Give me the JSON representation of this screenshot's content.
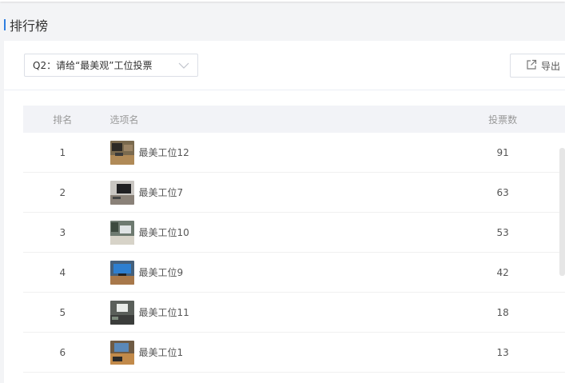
{
  "header": {
    "title": "排行榜"
  },
  "toolbar": {
    "question_select_value": "Q2：请给“最美观”工位投票",
    "export_label": "导出"
  },
  "table": {
    "columns": {
      "rank": "排名",
      "option": "选项名",
      "votes": "投票数"
    },
    "rows": [
      {
        "rank": "1",
        "name": "最美工位12",
        "votes": "91"
      },
      {
        "rank": "2",
        "name": "最美工位7",
        "votes": "63"
      },
      {
        "rank": "3",
        "name": "最美工位10",
        "votes": "53"
      },
      {
        "rank": "4",
        "name": "最美工位9",
        "votes": "42"
      },
      {
        "rank": "5",
        "name": "最美工位11",
        "votes": "18"
      },
      {
        "rank": "6",
        "name": "最美工位1",
        "votes": "13"
      }
    ]
  },
  "colors": {
    "accent": "#2f7fe0",
    "header_bg": "#f2f3f7"
  },
  "icons": [
    "chevron-down-icon",
    "export-icon",
    "workstation-photo"
  ]
}
